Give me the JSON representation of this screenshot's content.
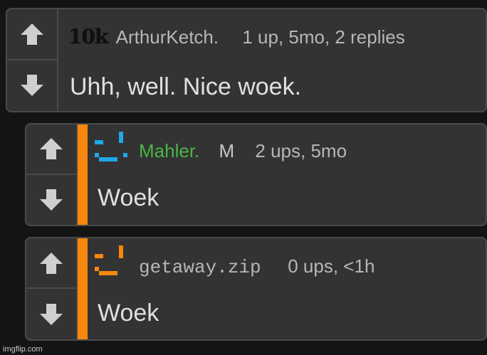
{
  "comments": [
    {
      "badge": "10k",
      "username": "ArthurKetch.",
      "meta": "1 up, 5mo, 2 replies",
      "text": "Uhh, well. Nice woek."
    },
    {
      "username": "Mahler.",
      "mod_tag": "M",
      "meta": "2 ups, 5mo",
      "text": "Woek",
      "avatar_color": "#1fa7e6"
    },
    {
      "username": "getaway.zip",
      "meta": "0 ups, <1h",
      "text": "Woek",
      "avatar_color": "#f7870e"
    }
  ],
  "colors": {
    "reply_stripe": "#f7870e",
    "mahler_username": "#4cb54a"
  },
  "icons": {
    "upvote": "arrow-up-icon",
    "downvote": "arrow-down-icon"
  },
  "watermark": "imgflip.com"
}
